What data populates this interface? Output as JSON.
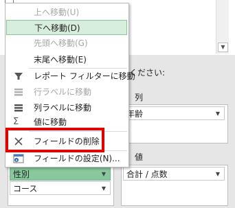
{
  "menu": {
    "items": [
      {
        "label": "上へ移動(U)",
        "state": "disabled",
        "icon": "none"
      },
      {
        "label": "下へ移動(D)",
        "state": "highlighted",
        "icon": "none"
      },
      {
        "label": "先頭へ移動(G)",
        "state": "disabled",
        "icon": "none"
      },
      {
        "label": "末尾へ移動(E)",
        "state": "enabled",
        "icon": "none"
      },
      {
        "label": "レポート フィルターに移動",
        "state": "enabled",
        "icon": "filter-icon"
      },
      {
        "label": "行ラベルに移動",
        "state": "disabled",
        "icon": "rows-icon"
      },
      {
        "label": "列ラベルに移動",
        "state": "enabled",
        "icon": "columns-icon"
      },
      {
        "label": "値に移動",
        "state": "enabled",
        "icon": "sigma-icon"
      },
      {
        "label": "フィールドの削除",
        "state": "enabled",
        "icon": "close-icon"
      },
      {
        "label": "フィールドの設定(N)...",
        "state": "enabled",
        "icon": "info-icon"
      }
    ]
  },
  "right_panel": {
    "drag_prompt": "ください:",
    "columns_heading": "列",
    "columns_item": "年齢",
    "values_heading": "値",
    "values_item": "合計 / 点数"
  },
  "left_panel": {
    "row_items": [
      "性別",
      "コース"
    ]
  },
  "colors": {
    "highlight_bg": "#d8eedd",
    "highlight_border": "#86c59a",
    "red_annotation": "#e00000",
    "green_field": "#88c89c"
  }
}
